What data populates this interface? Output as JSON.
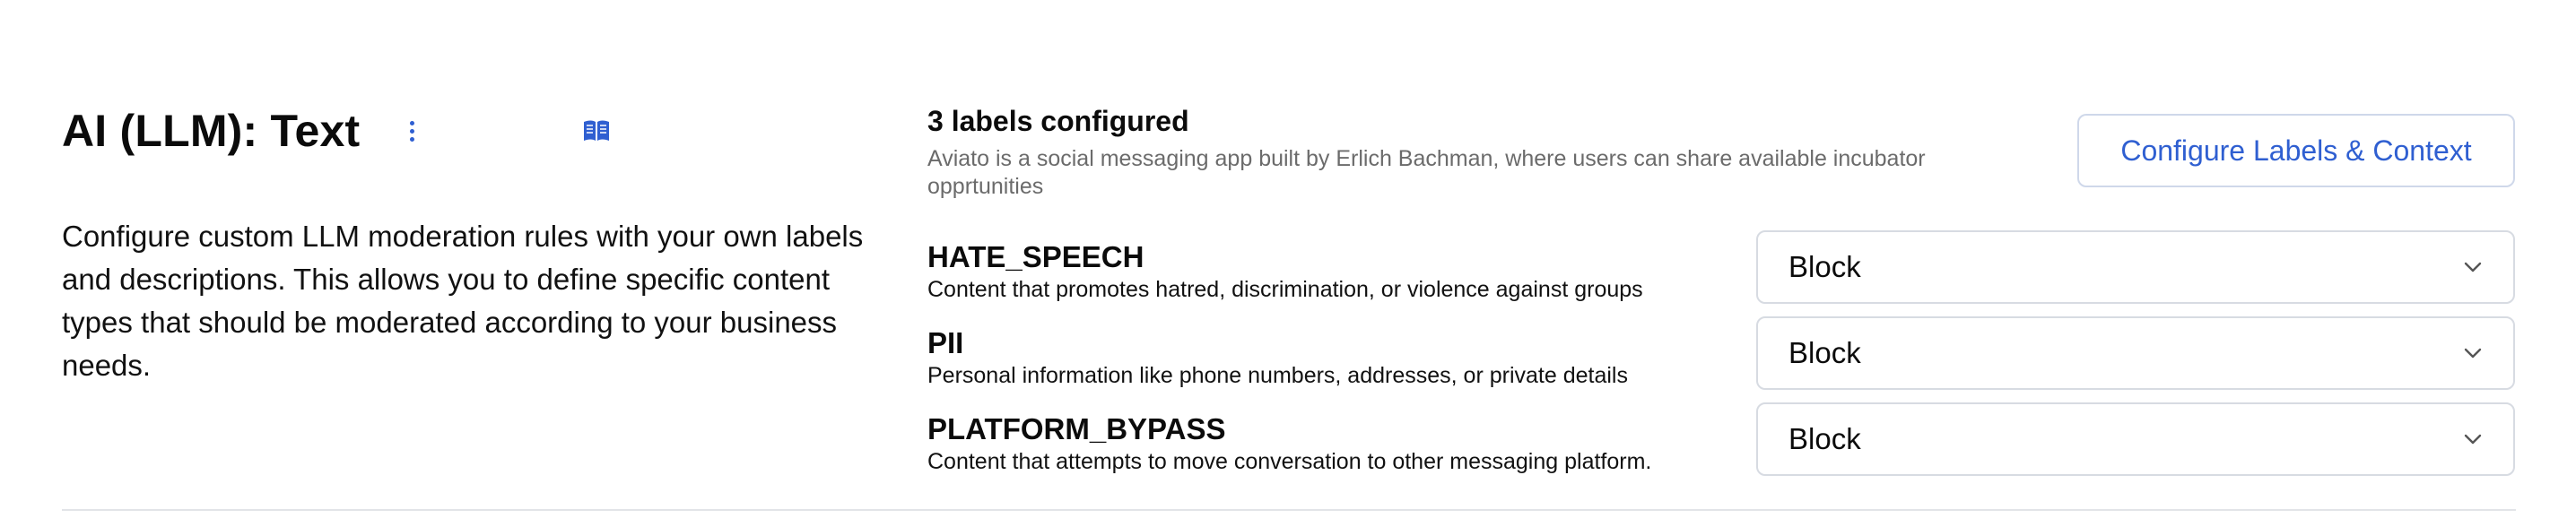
{
  "section": {
    "title": "AI (LLM): Text",
    "description": "Configure custom LLM moderation rules with your own labels and descriptions. This allows you to define specific content types that should be moderated according to your business needs."
  },
  "summary": {
    "title": "3 labels configured",
    "context": "Aviato is a social messaging app built by Erlich Bachman, where users can share available incubator opprtunities",
    "configure_label": "Configure Labels & Context"
  },
  "labels": [
    {
      "name": "HATE_SPEECH",
      "description": "Content that promotes hatred, discrimination, or violence against groups",
      "action": "Block"
    },
    {
      "name": "PII",
      "description": "Personal information like phone numbers, addresses, or private details",
      "action": "Block"
    },
    {
      "name": "PLATFORM_BYPASS",
      "description": "Content that attempts to move conversation to other messaging platform.",
      "action": "Block"
    }
  ],
  "icons": {
    "menu": "kebab-vertical-icon",
    "docs": "book-open-icon",
    "dropdown": "chevron-down-icon"
  },
  "colors": {
    "accent": "#2f5fd1",
    "muted_text": "#6b6b6b",
    "border": "#d7dbe2",
    "divider": "#e2e4e8"
  }
}
